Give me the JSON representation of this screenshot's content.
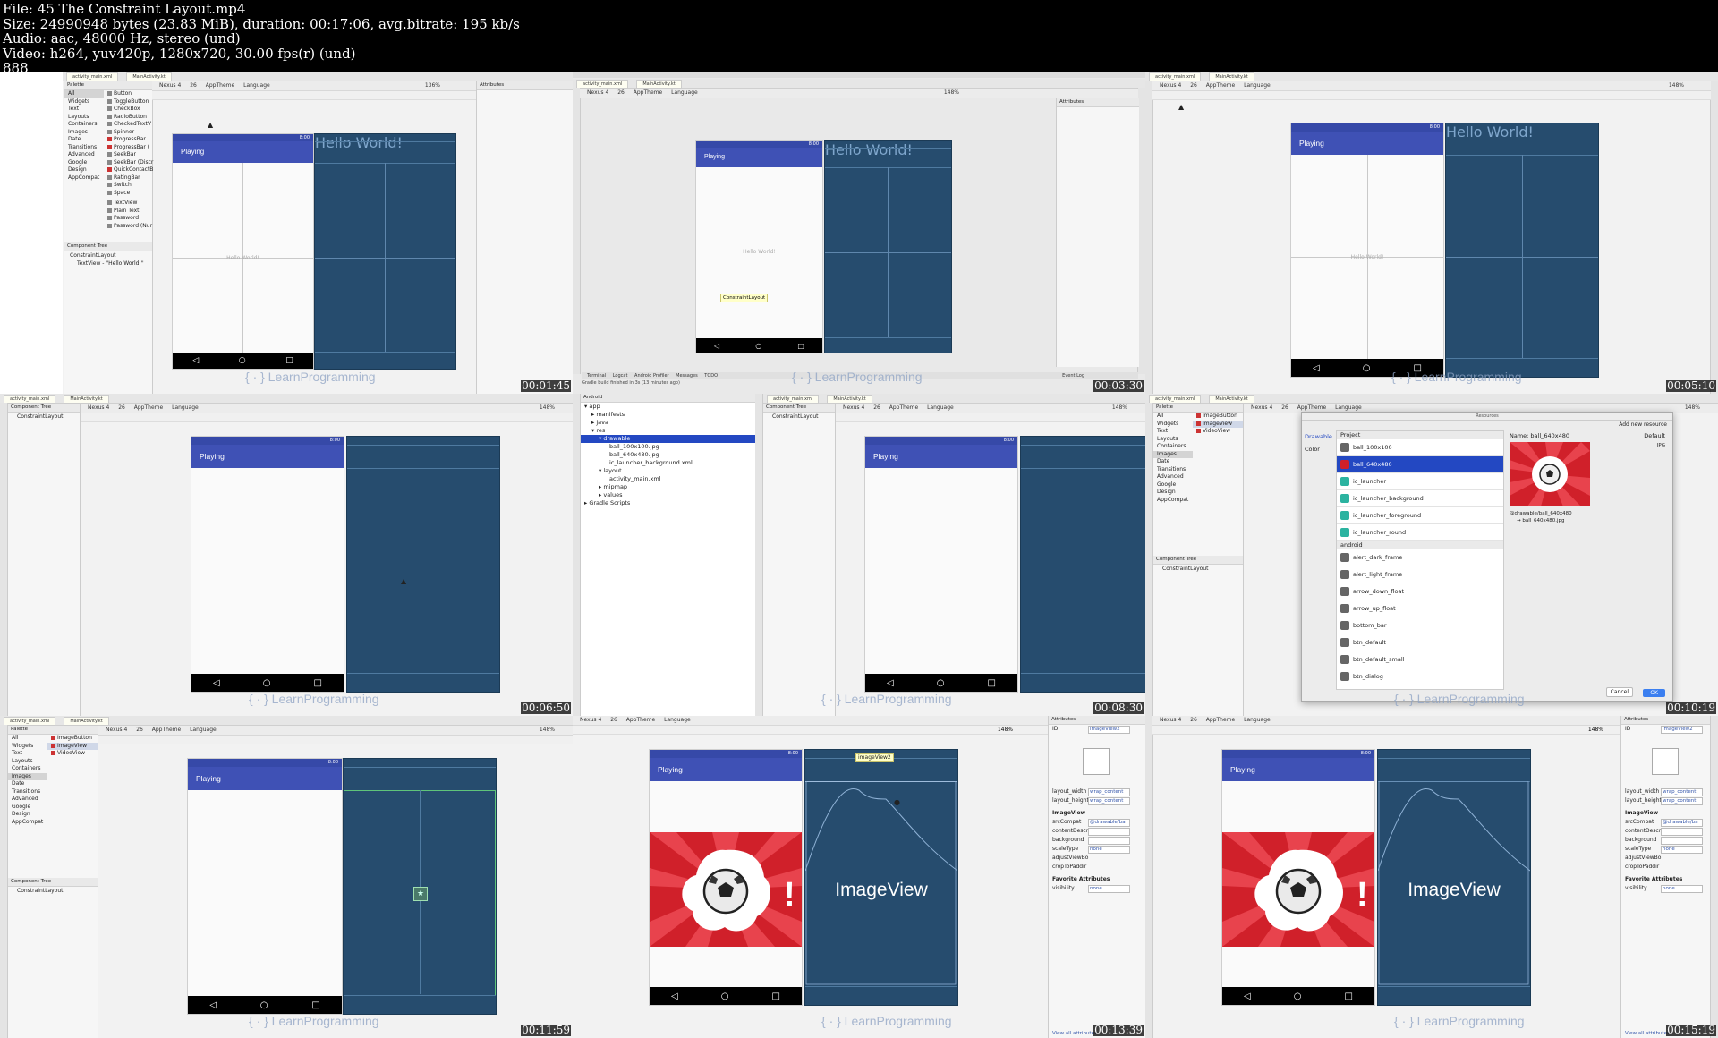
{
  "file_info": {
    "line1": "File: 45 The Constraint Layout.mp4",
    "line2": "Size: 24990948 bytes (23.83 MiB), duration: 00:17:06, avg.bitrate: 195 kb/s",
    "line3": "Audio: aac, 48000 Hz, stereo (und)",
    "line4": "Video: h264, yuv420p, 1280x720, 30.00 fps(r) (und)",
    "line5": "888"
  },
  "common": {
    "tab_layout": "activity_main.xml",
    "tab_code": "MainActivity.kt",
    "device": "Nexus 4",
    "api": "26",
    "theme": "AppTheme",
    "language": "Language",
    "app_title": "Playing",
    "hello": "Hello World!",
    "status_time": "8:00",
    "nav_back": "◁",
    "nav_home": "○",
    "nav_recent": "□",
    "palette": "Palette",
    "component_tree": "Component Tree",
    "attributes": "Attributes",
    "constraint_layout": "ConstraintLayout",
    "textview_item": "TextView - \"Hello World!\"",
    "watermark": "{ · } LearnProgramming",
    "imageview_label": "ImageView",
    "imageview_tooltip": "imageView2"
  },
  "palette_categories": [
    "All",
    "Widgets",
    "Text",
    "Layouts",
    "Containers",
    "Images",
    "Date",
    "Transitions",
    "Advanced",
    "Google",
    "Design",
    "AppCompat"
  ],
  "palette_widgets": [
    "Button",
    "ToggleButton",
    "CheckBox",
    "RadioButton",
    "CheckedTextV",
    "Spinner",
    "ProgressBar",
    "ProgressBar (",
    "SeekBar",
    "SeekBar (Discr",
    "QuickContactB",
    "RatingBar",
    "Switch",
    "Space",
    "TextView",
    "Plain Text",
    "Password",
    "Password (Nur"
  ],
  "palette_images": [
    "ImageButton",
    "ImageView",
    "VideoView"
  ],
  "project_tree": [
    "app",
    "manifests",
    "java",
    "res",
    "drawable",
    "ball_100x100.jpg",
    "ball_640x480.jpg",
    "ic_launcher_background.xml",
    "layout",
    "activity_main.xml",
    "mipmap",
    "values",
    "Gradle Scripts"
  ],
  "project_header": "Android",
  "resource_dialog": {
    "title": "Resources",
    "add_new": "Add new resource",
    "sidebar": [
      "Drawable",
      "Color"
    ],
    "project_header": "Project",
    "project_items": [
      "ball_100x100",
      "ball_640x480",
      "ic_launcher",
      "ic_launcher_background",
      "ic_launcher_foreground",
      "ic_launcher_round"
    ],
    "android_header": "android",
    "android_items": [
      "alert_dark_frame",
      "alert_light_frame",
      "arrow_down_float",
      "arrow_up_float",
      "bottom_bar",
      "btn_default",
      "btn_default_small",
      "btn_dialog"
    ],
    "name_label": "Name: ball_640x480",
    "default_label": "Default",
    "jpg_label": "JPG",
    "path_line1": "@drawable/ball_640x480",
    "path_line2": "→ ball_640x480.jpg",
    "cancel": "Cancel",
    "ok": "OK"
  },
  "attrs_panel": {
    "id_label": "ID",
    "id_value": "imageView2",
    "rows": [
      {
        "label": "layout_width",
        "value": "wrap_content"
      },
      {
        "label": "layout_height",
        "value": "wrap_content"
      }
    ],
    "section": "ImageView",
    "section_rows": [
      {
        "label": "srcCompat",
        "value": "@drawable/ba"
      },
      {
        "label": "contentDescri",
        "value": ""
      },
      {
        "label": "background",
        "value": ""
      },
      {
        "label": "scaleType",
        "value": "none"
      },
      {
        "label": "adjustViewBo",
        "value": ""
      },
      {
        "label": "cropToPaddir",
        "value": ""
      }
    ],
    "favorites": "Favorite Attributes",
    "visibility_label": "visibility",
    "visibility_value": "none",
    "view_all": "View all attributes"
  },
  "constraint_tooltip": "ConstraintLayout",
  "zoom": [
    "136%",
    "148%",
    "148%",
    "148%",
    "148%",
    "148%",
    "148%",
    "148%",
    "148%"
  ],
  "timestamps": [
    "00:01:45",
    "00:03:30",
    "00:05:10",
    "00:06:50",
    "00:08:30",
    "00:10:19",
    "00:11:59",
    "00:13:39",
    "00:15:19"
  ],
  "bottom_tabs": [
    "Terminal",
    "Logcat",
    "Android Profiler",
    "Messages",
    "TODO"
  ],
  "event_log": "Event Log",
  "status_line": "Gradle build finished in 3s (13 minutes ago)",
  "colors": {
    "appbar": "#3f51b5",
    "blueprint": "#264c6e",
    "selection": "#2348c2",
    "ball_red": "#d0202a"
  }
}
